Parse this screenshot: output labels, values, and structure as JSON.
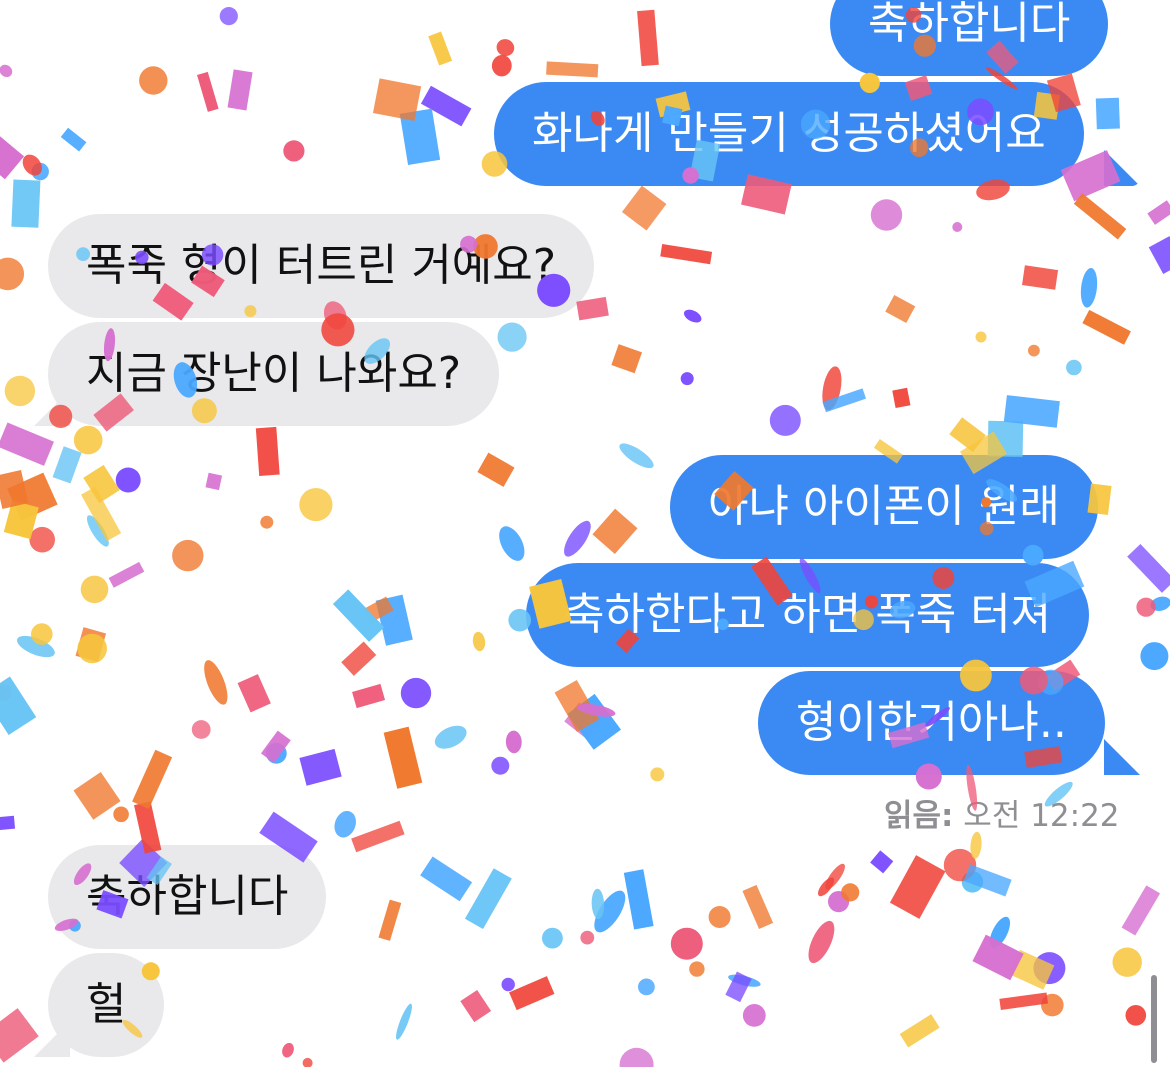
{
  "messages": [
    {
      "direction": "outgoing",
      "text": "축하합니다"
    },
    {
      "direction": "outgoing",
      "text": "화나게 만들기 성공하셨어요"
    },
    {
      "direction": "incoming",
      "text": "폭죽 형이 터트린 거예요?"
    },
    {
      "direction": "incoming",
      "text": "지금 장난이 나와요?"
    },
    {
      "direction": "outgoing",
      "text": "아냐 아이폰이 원래"
    },
    {
      "direction": "outgoing",
      "text": "축하한다고 하면 폭죽 터져"
    },
    {
      "direction": "outgoing",
      "text": "형이한거아냐.."
    },
    {
      "direction": "incoming",
      "text": "축하합니다"
    },
    {
      "direction": "incoming",
      "text": "헐"
    }
  ],
  "read_receipt": {
    "label": "읽음:",
    "time": "오전 12:22"
  },
  "colors": {
    "outgoing_bubble": "#3b8af3",
    "incoming_bubble": "#e9e9eb",
    "confetti": [
      "#f0443a",
      "#4aa8ff",
      "#7b4dff",
      "#f7c53c",
      "#ee5b7a",
      "#f0782e",
      "#d66fd0",
      "#66c4f5"
    ]
  },
  "effect": "confetti"
}
